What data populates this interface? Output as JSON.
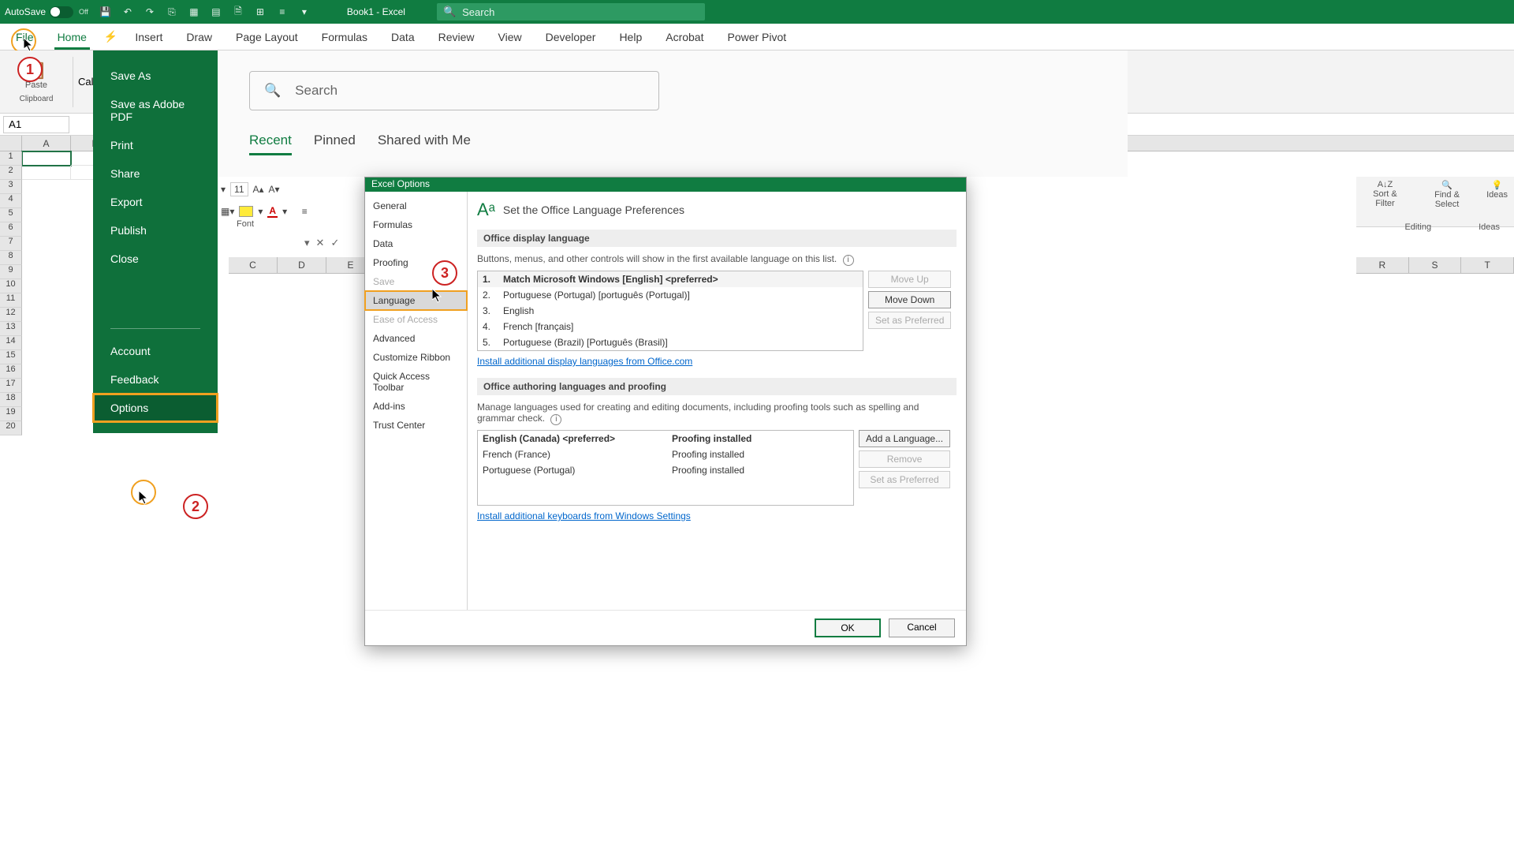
{
  "titlebar": {
    "autosave_label": "AutoSave",
    "autosave_state": "Off",
    "doc_title": "Book1 - Excel",
    "search_placeholder": "Search"
  },
  "ribbon_tabs": [
    "File",
    "Home",
    "Insert",
    "Draw",
    "Page Layout",
    "Formulas",
    "Data",
    "Review",
    "View",
    "Developer",
    "Help",
    "Acrobat",
    "Power Pivot"
  ],
  "active_tab": "Home",
  "clipboard_label": "Clipboard",
  "paste_label": "Paste",
  "font_group_label": "Font",
  "font_name": "Cali",
  "font_size": "11",
  "cell_ref": "A1",
  "col_headers": [
    "A",
    "B",
    "C",
    "D",
    "E"
  ],
  "col_headers_right": [
    "R",
    "S",
    "T"
  ],
  "row_headers": [
    "1",
    "2",
    "3",
    "4",
    "5",
    "6",
    "7",
    "8",
    "9",
    "10",
    "11",
    "12",
    "13",
    "14",
    "15",
    "16",
    "17",
    "18",
    "19",
    "20"
  ],
  "right_groups": {
    "sort": "Sort & Filter",
    "find": "Find & Select",
    "ideas": "Ideas",
    "editing": "Editing",
    "ideas_grp": "Ideas"
  },
  "backstage": {
    "items_top": [
      "Save As",
      "Save as Adobe PDF",
      "Print",
      "Share",
      "Export",
      "Publish",
      "Close"
    ],
    "items_bottom": [
      "Account",
      "Feedback",
      "Options"
    ]
  },
  "backstage_right": {
    "search_placeholder": "Search",
    "tabs": [
      "Recent",
      "Pinned",
      "Shared with Me"
    ]
  },
  "dialog": {
    "title": "Excel Options",
    "nav": [
      "General",
      "Formulas",
      "Data",
      "Proofing",
      "Save",
      "Language",
      "Ease of Access",
      "Advanced",
      "Customize Ribbon",
      "Quick Access Toolbar",
      "Add-ins",
      "Trust Center"
    ],
    "selected_nav": "Language",
    "heading": "Set the Office Language Preferences",
    "display_section": "Office display language",
    "display_hint": "Buttons, menus, and other controls will show in the first available language on this list.",
    "display_langs": [
      {
        "idx": "1.",
        "name": "Match Microsoft Windows [English] <preferred>",
        "bold": true
      },
      {
        "idx": "2.",
        "name": "Portuguese (Portugal) [português (Portugal)]"
      },
      {
        "idx": "3.",
        "name": "English"
      },
      {
        "idx": "4.",
        "name": "French [français]"
      },
      {
        "idx": "5.",
        "name": "Portuguese (Brazil) [Português (Brasil)]"
      }
    ],
    "btn_moveup": "Move Up",
    "btn_movedown": "Move Down",
    "btn_setpref": "Set as Preferred",
    "link_install_display": "Install additional display languages from Office.com",
    "auth_section": "Office authoring languages and proofing",
    "auth_hint": "Manage languages used for creating and editing documents, including proofing tools such as spelling and grammar check.",
    "auth_langs": [
      {
        "name": "English (Canada) <preferred>",
        "status": "Proofing installed",
        "bold": true
      },
      {
        "name": "French (France)",
        "status": "Proofing installed"
      },
      {
        "name": "Portuguese (Portugal)",
        "status": "Proofing installed"
      }
    ],
    "btn_addlang": "Add a Language...",
    "btn_remove": "Remove",
    "btn_setpref2": "Set as Preferred",
    "link_install_kbd": "Install additional keyboards from Windows Settings",
    "ok": "OK",
    "cancel": "Cancel"
  },
  "steps": {
    "s1": "1",
    "s2": "2",
    "s3": "3"
  }
}
